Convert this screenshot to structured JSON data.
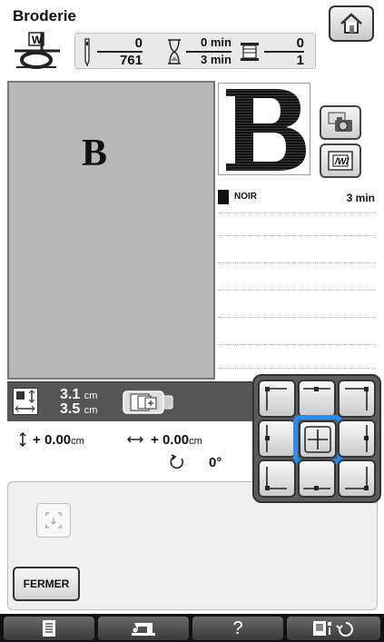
{
  "header": {
    "title": "Broderie",
    "stitch_current": "0",
    "stitch_total": "761",
    "time_current": "0 min",
    "time_total": "3 min",
    "color_current": "0",
    "color_total": "1"
  },
  "preview": {
    "letter": "B"
  },
  "colors": [
    {
      "name": "NOIR",
      "time": "3 min",
      "swatch": "#111111"
    }
  ],
  "size": {
    "height": "3.1",
    "width": "3.5",
    "unit": "cm"
  },
  "offset": {
    "vertical_sign": "+",
    "vertical": "0.00",
    "horizontal_sign": "+",
    "horizontal": "0.00",
    "unit": "cm",
    "rotation": "0°"
  },
  "buttons": {
    "close": "FERMER"
  },
  "pad": {
    "selected": "center"
  },
  "bottombar": {
    "help": "?"
  },
  "colors_theme": {
    "accent": "#1e90ff",
    "preview_bg": "#b8b8b8",
    "strip_bg": "#555555"
  }
}
